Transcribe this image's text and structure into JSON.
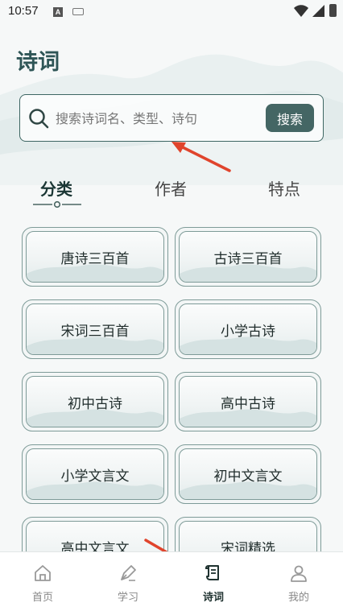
{
  "status_bar": {
    "time": "10:57",
    "notification_letter": "A"
  },
  "header": {
    "title": "诗词"
  },
  "search": {
    "placeholder": "搜索诗词名、类型、诗句",
    "button_label": "搜索"
  },
  "tabs": [
    {
      "label": "分类",
      "active": true
    },
    {
      "label": "作者",
      "active": false
    },
    {
      "label": "特点",
      "active": false
    }
  ],
  "categories": [
    "唐诗三百首",
    "古诗三百首",
    "宋词三百首",
    "小学古诗",
    "初中古诗",
    "高中古诗",
    "小学文言文",
    "初中文言文",
    "高中文言文",
    "宋词精选"
  ],
  "bottom_nav": [
    {
      "label": "首页",
      "icon": "home-icon",
      "active": false
    },
    {
      "label": "学习",
      "icon": "pen-icon",
      "active": false
    },
    {
      "label": "诗词",
      "icon": "scroll-icon",
      "active": true
    },
    {
      "label": "我的",
      "icon": "person-icon",
      "active": false
    }
  ],
  "colors": {
    "accent": "#446664",
    "border": "#7e9b98",
    "annotation_arrow": "#e0442c"
  }
}
